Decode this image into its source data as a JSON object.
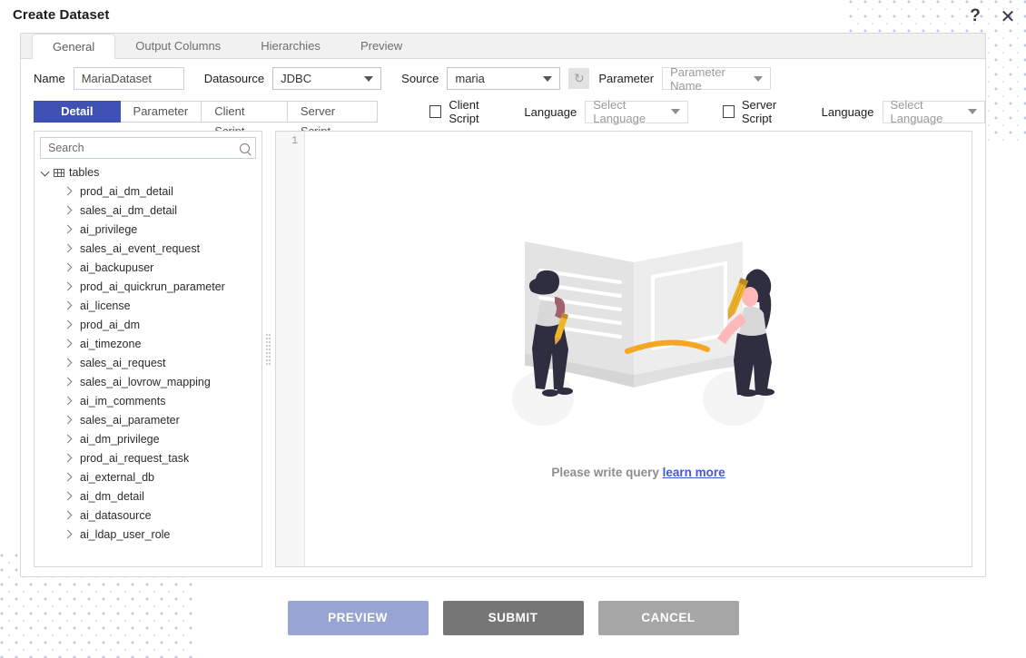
{
  "window": {
    "title": "Create Dataset",
    "help_icon": "question-mark-icon",
    "help_label": "?",
    "close_icon": "close-icon",
    "close_label": "✕"
  },
  "top_tabs": [
    {
      "label": "General",
      "active": true
    },
    {
      "label": "Output Columns",
      "active": false
    },
    {
      "label": "Hierarchies",
      "active": false
    },
    {
      "label": "Preview",
      "active": false
    }
  ],
  "form": {
    "name_label": "Name",
    "name_value": "MariaDataset",
    "name_placeholder": "Name",
    "datasource_label": "Datasource",
    "datasource_value": "JDBC",
    "source_label": "Source",
    "source_value": "maria",
    "refresh_icon": "refresh-icon",
    "refresh_glyph": "↻",
    "parameter_label": "Parameter",
    "parameter_value": "Parameter Name"
  },
  "sub_tabs": [
    {
      "label": "Detail",
      "active": true
    },
    {
      "label": "Parameter",
      "active": false
    },
    {
      "label": "Client Script",
      "active": false
    },
    {
      "label": "Server Script",
      "active": false
    }
  ],
  "script_options": {
    "client_script_label": "Client Script",
    "client_script_checked": false,
    "client_language_label": "Language",
    "client_language_value": "Select Language",
    "server_script_label": "Server Script",
    "server_script_checked": false,
    "server_language_label": "Language",
    "server_language_value": "Select Language"
  },
  "tree": {
    "search_placeholder": "Search",
    "search_value": "",
    "search_icon": "search-icon",
    "root_label": "tables",
    "root_icon": "table-grid-icon",
    "items": [
      {
        "label": "prod_ai_dm_detail"
      },
      {
        "label": "sales_ai_dm_detail"
      },
      {
        "label": "ai_privilege"
      },
      {
        "label": "sales_ai_event_request"
      },
      {
        "label": "ai_backupuser"
      },
      {
        "label": "prod_ai_quickrun_parameter"
      },
      {
        "label": "ai_license"
      },
      {
        "label": "prod_ai_dm"
      },
      {
        "label": "ai_timezone"
      },
      {
        "label": "sales_ai_request"
      },
      {
        "label": "sales_ai_lovrow_mapping"
      },
      {
        "label": "ai_im_comments"
      },
      {
        "label": "sales_ai_parameter"
      },
      {
        "label": "ai_dm_privilege"
      },
      {
        "label": "prod_ai_request_task"
      },
      {
        "label": "ai_external_db"
      },
      {
        "label": "ai_dm_detail"
      },
      {
        "label": "ai_datasource"
      },
      {
        "label": "ai_ldap_user_role"
      }
    ]
  },
  "editor": {
    "line_number": "1",
    "query_value": "",
    "empty_illustration": "people-reading-book-illustration",
    "hint_text": "Please write query",
    "hint_link": "learn more"
  },
  "footer": {
    "buttons": [
      {
        "label": "PREVIEW",
        "color": "#97a4d4"
      },
      {
        "label": "SUBMIT",
        "color": "#767676"
      },
      {
        "label": "CANCEL",
        "color": "#a6a6a6"
      }
    ]
  },
  "colors": {
    "accent": "#3f51b5",
    "link": "#3b5bdb",
    "dots": "#c3c9ef"
  }
}
